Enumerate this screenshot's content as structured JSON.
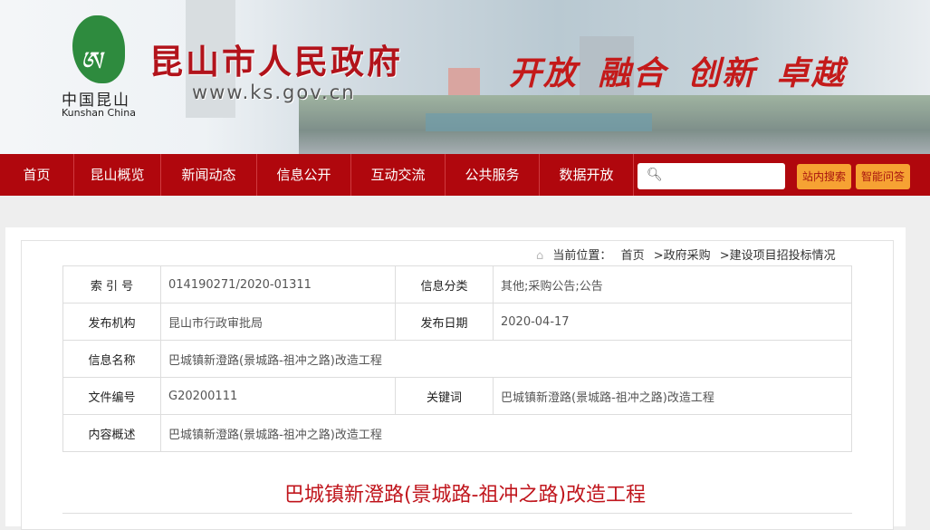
{
  "header": {
    "title": "昆山市人民政府",
    "url": "www.ks.gov.cn",
    "logo_cn": "中国昆山",
    "logo_en": "Kunshan China",
    "slogan": "开放 融合 创新 卓越"
  },
  "nav": {
    "items": [
      "首页",
      "昆山概览",
      "新闻动态",
      "信息公开",
      "互动交流",
      "公共服务",
      "数据开放"
    ],
    "search_placeholder": "",
    "site_search": "站内搜索",
    "smart_qa": "智能问答"
  },
  "breadcrumb": {
    "label": "当前位置：",
    "items": [
      "首页",
      ">政府采购",
      ">建设项目招投标情况"
    ]
  },
  "info": {
    "index_label": "索 引 号",
    "index": "014190271/2020-01311",
    "category_label": "信息分类",
    "category": "其他;采购公告;公告",
    "publisher_label": "发布机构",
    "publisher": "昆山市行政审批局",
    "date_label": "发布日期",
    "date": "2020-04-17",
    "name_label": "信息名称",
    "name": "巴城镇新澄路(景城路-祖冲之路)改造工程",
    "docno_label": "文件编号",
    "docno": "G20200111",
    "keywords_label": "关键词",
    "keywords": "巴城镇新澄路(景城路-祖冲之路)改造工程",
    "summary_label": "内容概述",
    "summary": "巴城镇新澄路(景城路-祖冲之路)改造工程"
  },
  "doc_title": "巴城镇新澄路(景城路-祖冲之路)改造工程"
}
